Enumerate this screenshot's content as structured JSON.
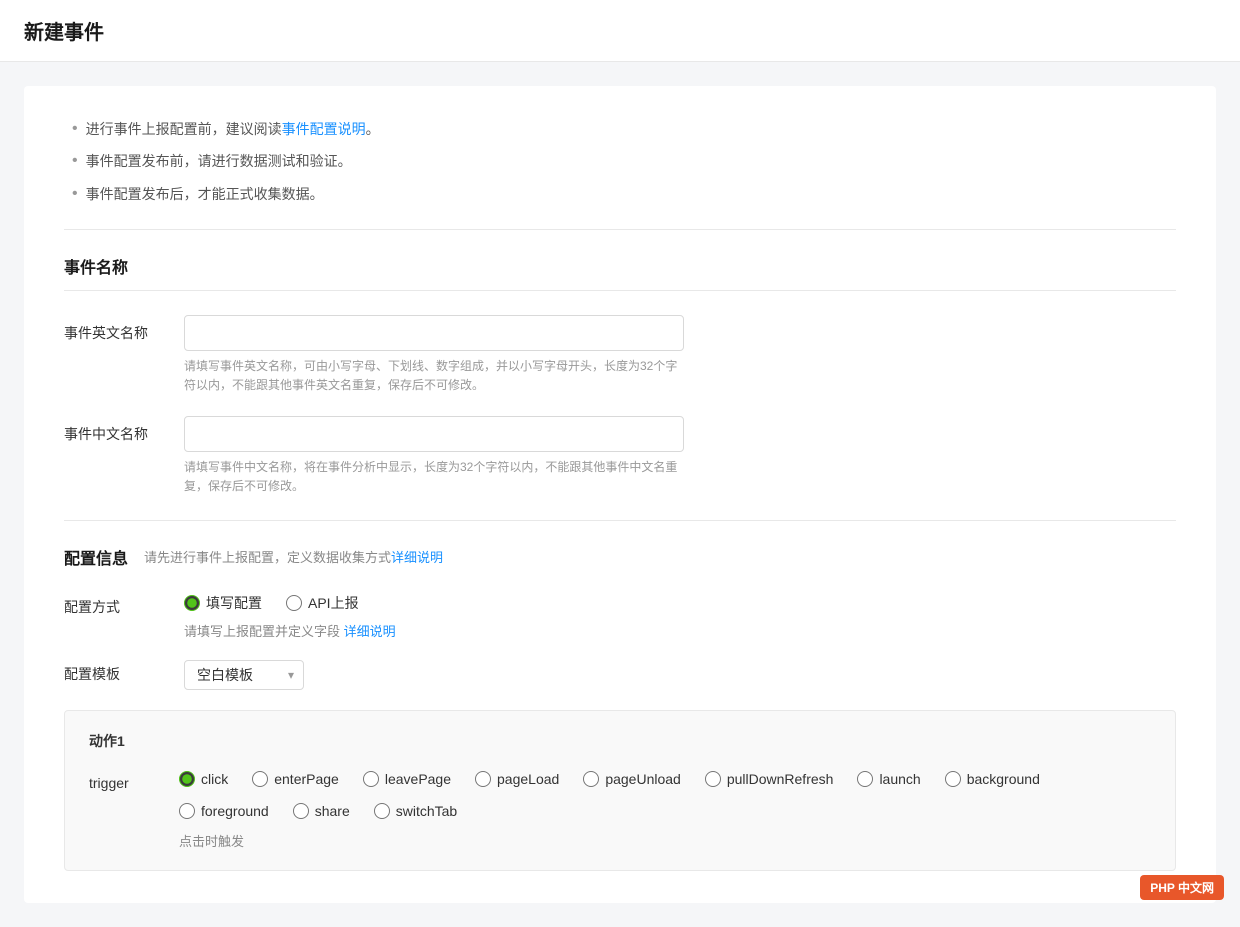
{
  "page": {
    "title": "新建事件"
  },
  "notices": [
    {
      "text": "进行事件上报配置前，建议阅读",
      "link_text": "事件配置说明",
      "suffix": "。"
    },
    {
      "text": "事件配置发布前，请进行数据测试和验证。"
    },
    {
      "text": "事件配置发布后，才能正式收集数据。"
    }
  ],
  "sections": {
    "event_name": {
      "title": "事件名称",
      "english_name": {
        "label": "事件英文名称",
        "placeholder": "",
        "hint": "请填写事件英文名称，可由小写字母、下划线、数字组成，并以小写字母开头，长度为32个字符以内，不能跟其他事件英文名重复，保存后不可修改。"
      },
      "chinese_name": {
        "label": "事件中文名称",
        "placeholder": "",
        "hint": "请填写事件中文名称，将在事件分析中显示，长度为32个字符以内，不能跟其他事件中文名重复，保存后不可修改。"
      }
    },
    "config_info": {
      "title": "配置信息",
      "desc": "请先进行事件上报配置，定义数据收集方式",
      "desc_link": "详细说明",
      "config_method": {
        "label": "配置方式",
        "options": [
          {
            "id": "fill",
            "label": "填写配置",
            "checked": true
          },
          {
            "id": "api",
            "label": "API上报",
            "checked": false
          }
        ],
        "hint": "请填写上报配置并定义字段",
        "hint_link": "详细说明"
      },
      "config_template": {
        "label": "配置模板",
        "options": [
          {
            "value": "empty",
            "label": "空白模板"
          }
        ],
        "selected": "空白模板"
      }
    },
    "action": {
      "title": "动作1",
      "trigger": {
        "label": "trigger",
        "options": [
          {
            "id": "click",
            "label": "click",
            "checked": true
          },
          {
            "id": "enterPage",
            "label": "enterPage",
            "checked": false
          },
          {
            "id": "leavePage",
            "label": "leavePage",
            "checked": false
          },
          {
            "id": "pageLoad",
            "label": "pageLoad",
            "checked": false
          },
          {
            "id": "pageUnload",
            "label": "pageUnload",
            "checked": false
          },
          {
            "id": "pullDownRefresh",
            "label": "pullDownRefresh",
            "checked": false
          },
          {
            "id": "launch",
            "label": "launch",
            "checked": false
          },
          {
            "id": "background",
            "label": "background",
            "checked": false
          },
          {
            "id": "foreground",
            "label": "foreground",
            "checked": false
          },
          {
            "id": "share",
            "label": "share",
            "checked": false
          },
          {
            "id": "switchTab",
            "label": "switchTab",
            "checked": false
          }
        ],
        "hint": "点击时触发"
      }
    }
  },
  "php_badge": {
    "text": "PHP 中文网"
  }
}
